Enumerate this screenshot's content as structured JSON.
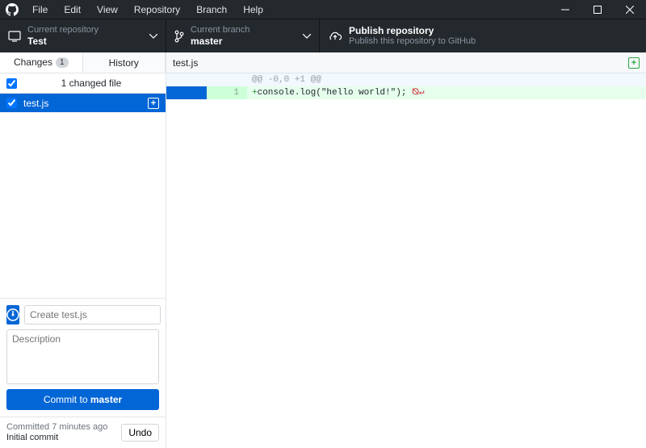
{
  "menu": [
    "File",
    "Edit",
    "View",
    "Repository",
    "Branch",
    "Help"
  ],
  "repo": {
    "label": "Current repository",
    "name": "Test"
  },
  "branch": {
    "label": "Current branch",
    "name": "master"
  },
  "publish": {
    "title": "Publish repository",
    "desc": "Publish this repository to GitHub"
  },
  "tabs": {
    "changes": "Changes",
    "changes_count": "1",
    "history": "History"
  },
  "changes_header": "1 changed file",
  "files": [
    {
      "name": "test.js"
    }
  ],
  "diff": {
    "filename": "test.js",
    "hunk": "@@ -0,0 +1 @@",
    "line_num": "1",
    "plus": "+",
    "code": "console.log(\"hello world!\"); ",
    "eof_sym": "⦰↵"
  },
  "commit": {
    "summary_placeholder": "Create test.js",
    "desc_placeholder": "Description",
    "btn_prefix": "Commit to ",
    "btn_branch": "master"
  },
  "last_commit": {
    "time": "Committed 7 minutes ago",
    "msg": "Initial commit",
    "undo": "Undo"
  }
}
